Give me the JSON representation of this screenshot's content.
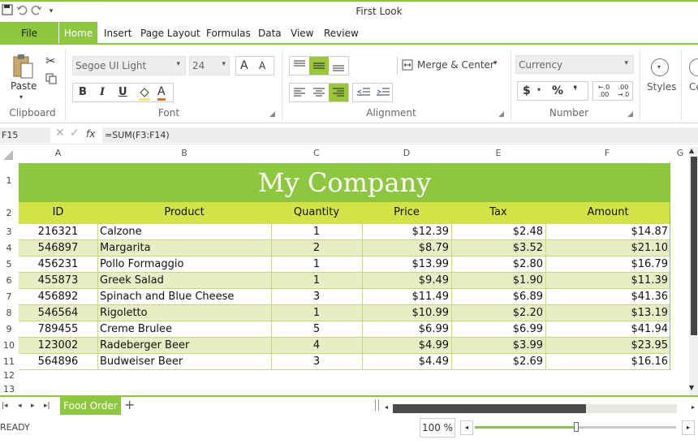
{
  "app": {
    "title": "First Look"
  },
  "quick_access": {
    "save": "save-icon",
    "undo": "undo-icon",
    "redo": "redo-icon",
    "more": "▾"
  },
  "tabs": [
    "File",
    "Home",
    "Insert",
    "Page Layout",
    "Formulas",
    "Data",
    "View",
    "Review"
  ],
  "ribbon": {
    "clipboard": {
      "label": "Clipboard",
      "paste": "Paste"
    },
    "font": {
      "label": "Font",
      "family": "Segoe UI Light",
      "size": "24",
      "bold": "B",
      "italic": "I",
      "underline": "U",
      "grow": "A",
      "shrink": "A",
      "fontcolor": "A"
    },
    "alignment": {
      "label": "Alignment",
      "merge": "Merge & Center"
    },
    "number": {
      "label": "Number",
      "format": "Currency",
      "currency": "$",
      "percent": "%",
      "comma": "❜",
      "inc_decimal": ".0→.00",
      "dec_decimal": ".00→.0"
    },
    "styles": {
      "label": "Styles"
    },
    "cells": {
      "label": "Ce"
    }
  },
  "formula_bar": {
    "name_box": "F15",
    "fx": "fx",
    "formula": "=SUM(F3:F14)"
  },
  "columns": [
    "A",
    "B",
    "C",
    "D",
    "E",
    "F",
    "G"
  ],
  "rows": [
    "1",
    "2",
    "3",
    "4",
    "5",
    "6",
    "7",
    "8",
    "9",
    "10",
    "11",
    "12",
    "13"
  ],
  "sheet": {
    "title": "My Company",
    "headers": [
      "ID",
      "Product",
      "Quantity",
      "Price",
      "Tax",
      "Amount"
    ],
    "data": [
      [
        "216321",
        "Calzone",
        "1",
        "$12.39",
        "$2.48",
        "$14.87"
      ],
      [
        "546897",
        "Margarita",
        "2",
        "$8.79",
        "$3.52",
        "$21.10"
      ],
      [
        "456231",
        "Pollo Formaggio",
        "1",
        "$13.99",
        "$2.80",
        "$16.79"
      ],
      [
        "455873",
        "Greek Salad",
        "1",
        "$9.49",
        "$1.90",
        "$11.39"
      ],
      [
        "456892",
        "Spinach and Blue Cheese",
        "3",
        "$11.49",
        "$6.89",
        "$41.36"
      ],
      [
        "546564",
        "Rigoletto",
        "1",
        "$10.99",
        "$2.20",
        "$13.19"
      ],
      [
        "789455",
        "Creme Brulee",
        "5",
        "$6.99",
        "$6.99",
        "$41.94"
      ],
      [
        "123002",
        "Radeberger Beer",
        "4",
        "$4.99",
        "$3.99",
        "$23.95"
      ],
      [
        "564896",
        "Budweiser Beer",
        "3",
        "$4.49",
        "$2.69",
        "$16.16"
      ]
    ]
  },
  "sheet_tabs": {
    "active": "Food Order",
    "add": "+"
  },
  "status": {
    "ready": "READY",
    "zoom": "100 %",
    "zoom_level_percent": 100
  },
  "colors": {
    "accent": "#8dc63f",
    "header_row": "#d3e346",
    "title_band": "#8dc63f",
    "alt_row": "#e6efc4"
  }
}
